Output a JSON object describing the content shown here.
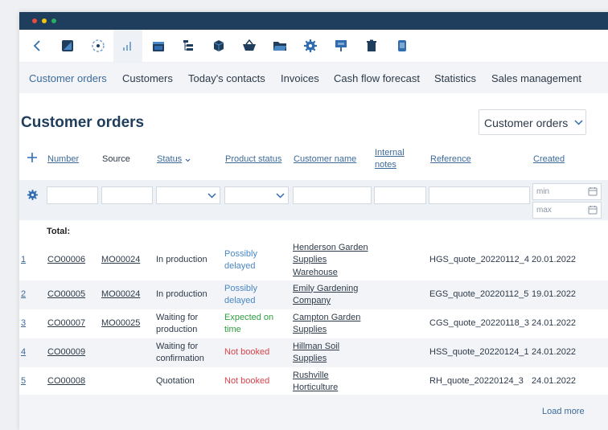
{
  "app": {
    "window_dots": [
      "#e74c3c",
      "#f1c40f",
      "#27ae60"
    ]
  },
  "toolbar": {
    "icons": [
      "back-icon",
      "dashboard-icon",
      "loading-icon",
      "chart-icon",
      "calendar-icon",
      "tree-icon",
      "box-icon",
      "basket-icon",
      "folder-icon",
      "gear-icon",
      "presentation-icon",
      "trash-icon",
      "document-icon"
    ]
  },
  "nav": {
    "items": [
      "Customer orders",
      "Customers",
      "Today's contacts",
      "Invoices",
      "Cash flow forecast",
      "Statistics",
      "Sales management"
    ]
  },
  "page": {
    "title": "Customer orders",
    "view_select": "Customer orders"
  },
  "table": {
    "headers": {
      "number": "Number",
      "source": "Source",
      "status": "Status",
      "product_status": "Product status",
      "customer_name": "Customer name",
      "internal_notes_1": "Internal",
      "internal_notes_2": "notes",
      "reference": "Reference",
      "created": "Created"
    },
    "filters": {
      "min_placeholder": "min",
      "max_placeholder": "max"
    },
    "total_label": "Total:",
    "rows": [
      {
        "index": "1",
        "number": "CO00006",
        "source": "MO00024",
        "status": [
          "In production"
        ],
        "product_status": [
          "Possibly",
          "delayed"
        ],
        "product_status_color": "#4a87c5",
        "customer": [
          "Henderson Garden",
          "Supplies",
          "Warehouse"
        ],
        "reference": "HGS_quote_20220112_4",
        "created": "20.01.2022"
      },
      {
        "index": "2",
        "number": "CO00005",
        "source": "MO00024",
        "status": [
          "In production"
        ],
        "product_status": [
          "Possibly",
          "delayed"
        ],
        "product_status_color": "#4a87c5",
        "customer": [
          "Emily Gardening",
          "Company"
        ],
        "reference": "EGS_quote_20220112_5",
        "created": "19.01.2022"
      },
      {
        "index": "3",
        "number": "CO00007",
        "source": "MO00025",
        "status": [
          "Waiting for",
          "production"
        ],
        "product_status": [
          "Expected on",
          "time"
        ],
        "product_status_color": "#2e9e3f",
        "customer": [
          "Campton Garden",
          "Supplies"
        ],
        "reference": "CGS_quote_20220118_3",
        "created": "24.01.2022"
      },
      {
        "index": "4",
        "number": "CO00009",
        "source": "",
        "status": [
          "Waiting for",
          "confirmation"
        ],
        "product_status": [
          "Not booked"
        ],
        "product_status_color": "#d9434a",
        "customer": [
          "Hillman Soil",
          "Supplies"
        ],
        "reference": "HSS_quote_20220124_1",
        "created": "24.01.2022"
      },
      {
        "index": "5",
        "number": "CO00008",
        "source": "",
        "status": [
          "Quotation"
        ],
        "product_status": [
          "Not booked"
        ],
        "product_status_color": "#d9434a",
        "customer": [
          "Rushville",
          "Horticulture"
        ],
        "reference": "RH_quote_20220124_3",
        "created": "24.01.2022"
      }
    ],
    "load_more": "Load more"
  }
}
